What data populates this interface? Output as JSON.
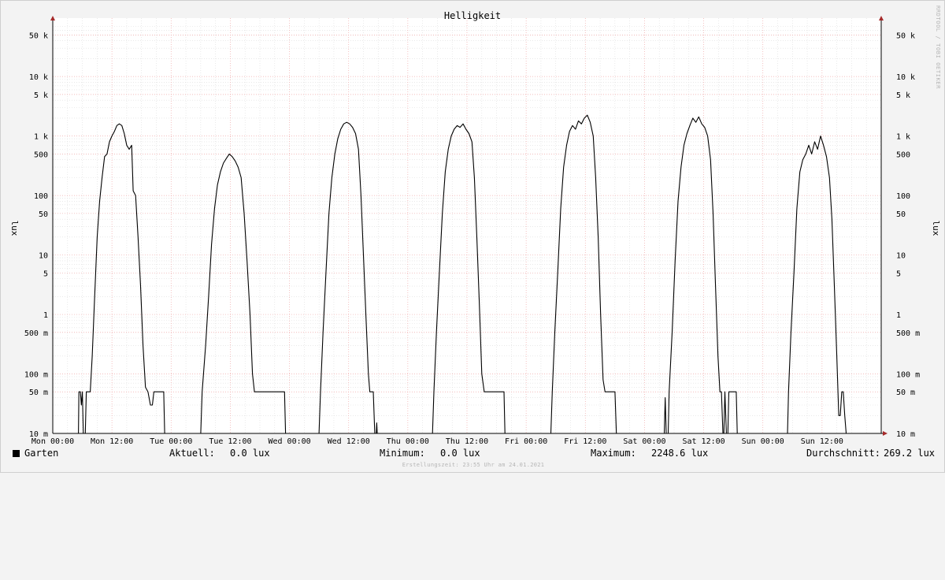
{
  "chart_data": {
    "type": "line",
    "title": "Helligkeit",
    "ylabel": "lux",
    "yscale": "log",
    "ylim": [
      0.01,
      80000
    ],
    "y_ticks": [
      {
        "v": 0.01,
        "label": "10 m"
      },
      {
        "v": 0.05,
        "label": "50 m"
      },
      {
        "v": 0.1,
        "label": "100 m"
      },
      {
        "v": 0.5,
        "label": "500 m"
      },
      {
        "v": 1,
        "label": "1"
      },
      {
        "v": 5,
        "label": "5"
      },
      {
        "v": 10,
        "label": "10"
      },
      {
        "v": 50,
        "label": "50"
      },
      {
        "v": 100,
        "label": "100"
      },
      {
        "v": 500,
        "label": "500"
      },
      {
        "v": 1000,
        "label": "1 k"
      },
      {
        "v": 5000,
        "label": "5 k"
      },
      {
        "v": 10000,
        "label": "10 k"
      },
      {
        "v": 50000,
        "label": "50 k"
      }
    ],
    "xlim": [
      "Mon 00:00",
      "Mon 00:00 (next week)"
    ],
    "x_tick_labels": [
      "Mon 00:00",
      "Mon 12:00",
      "Tue 00:00",
      "Tue 12:00",
      "Wed 00:00",
      "Wed 12:00",
      "Thu 00:00",
      "Thu 12:00",
      "Fri 00:00",
      "Fri 12:00",
      "Sat 00:00",
      "Sat 12:00",
      "Sun 00:00",
      "Sun 12:00"
    ],
    "x_hours_per_tick": 12,
    "grid": true,
    "series": [
      {
        "name": "Garten",
        "color": "#000000",
        "x_unit": "hours since Mon 00:00",
        "points": [
          [
            0,
            0.01
          ],
          [
            5.2,
            0.01
          ],
          [
            5.3,
            0.05
          ],
          [
            5.6,
            0.05
          ],
          [
            5.8,
            0.03
          ],
          [
            6.0,
            0.05
          ],
          [
            6.2,
            0.01
          ],
          [
            6.6,
            0.01
          ],
          [
            6.8,
            0.05
          ],
          [
            7.6,
            0.05
          ],
          [
            8.0,
            0.2
          ],
          [
            8.5,
            2
          ],
          [
            9.0,
            20
          ],
          [
            9.5,
            80
          ],
          [
            10.0,
            200
          ],
          [
            10.5,
            450
          ],
          [
            11.0,
            500
          ],
          [
            11.5,
            800
          ],
          [
            12.0,
            1000
          ],
          [
            12.5,
            1200
          ],
          [
            13.0,
            1500
          ],
          [
            13.5,
            1600
          ],
          [
            14.0,
            1500
          ],
          [
            14.5,
            1100
          ],
          [
            15.0,
            700
          ],
          [
            15.5,
            600
          ],
          [
            16.0,
            700
          ],
          [
            16.3,
            120
          ],
          [
            16.8,
            100
          ],
          [
            17.3,
            20
          ],
          [
            17.8,
            3
          ],
          [
            18.3,
            0.3
          ],
          [
            18.8,
            0.06
          ],
          [
            19.3,
            0.05
          ],
          [
            19.8,
            0.03
          ],
          [
            20.2,
            0.03
          ],
          [
            20.5,
            0.05
          ],
          [
            22.5,
            0.05
          ],
          [
            22.7,
            0.01
          ],
          [
            30.0,
            0.01
          ],
          [
            30.3,
            0.05
          ],
          [
            31.0,
            0.3
          ],
          [
            31.6,
            2
          ],
          [
            32.2,
            15
          ],
          [
            32.8,
            60
          ],
          [
            33.4,
            150
          ],
          [
            34.0,
            250
          ],
          [
            34.6,
            350
          ],
          [
            35.2,
            420
          ],
          [
            35.8,
            500
          ],
          [
            36.4,
            450
          ],
          [
            37.0,
            380
          ],
          [
            37.6,
            300
          ],
          [
            38.2,
            200
          ],
          [
            38.8,
            50
          ],
          [
            39.4,
            8
          ],
          [
            40.0,
            1
          ],
          [
            40.5,
            0.1
          ],
          [
            40.9,
            0.05
          ],
          [
            47.0,
            0.05
          ],
          [
            47.2,
            0.01
          ],
          [
            54.0,
            0.01
          ],
          [
            54.3,
            0.05
          ],
          [
            54.8,
            0.5
          ],
          [
            55.4,
            5
          ],
          [
            56.0,
            50
          ],
          [
            56.6,
            200
          ],
          [
            57.2,
            500
          ],
          [
            57.8,
            900
          ],
          [
            58.4,
            1300
          ],
          [
            59.0,
            1600
          ],
          [
            59.6,
            1700
          ],
          [
            60.2,
            1600
          ],
          [
            60.8,
            1400
          ],
          [
            61.4,
            1100
          ],
          [
            62.0,
            600
          ],
          [
            62.5,
            100
          ],
          [
            63.0,
            10
          ],
          [
            63.5,
            1
          ],
          [
            64.0,
            0.1
          ],
          [
            64.3,
            0.05
          ],
          [
            65.0,
            0.05
          ],
          [
            65.3,
            0.01
          ],
          [
            65.6,
            0.01
          ],
          [
            65.7,
            0.015
          ],
          [
            65.8,
            0.01
          ],
          [
            77.0,
            0.01
          ],
          [
            77.3,
            0.05
          ],
          [
            77.8,
            0.5
          ],
          [
            78.4,
            5
          ],
          [
            79.0,
            50
          ],
          [
            79.6,
            250
          ],
          [
            80.2,
            600
          ],
          [
            80.8,
            1000
          ],
          [
            81.4,
            1300
          ],
          [
            82.0,
            1500
          ],
          [
            82.6,
            1400
          ],
          [
            83.2,
            1600
          ],
          [
            83.8,
            1300
          ],
          [
            84.4,
            1100
          ],
          [
            85.0,
            800
          ],
          [
            85.5,
            200
          ],
          [
            86.0,
            20
          ],
          [
            86.5,
            1.5
          ],
          [
            87.0,
            0.1
          ],
          [
            87.5,
            0.05
          ],
          [
            91.5,
            0.05
          ],
          [
            91.7,
            0.01
          ],
          [
            101.0,
            0.01
          ],
          [
            101.3,
            0.05
          ],
          [
            101.8,
            0.5
          ],
          [
            102.4,
            5
          ],
          [
            103.0,
            60
          ],
          [
            103.6,
            300
          ],
          [
            104.2,
            700
          ],
          [
            104.8,
            1200
          ],
          [
            105.4,
            1500
          ],
          [
            106.0,
            1300
          ],
          [
            106.6,
            1800
          ],
          [
            107.2,
            1600
          ],
          [
            107.8,
            2000
          ],
          [
            108.4,
            2248.6
          ],
          [
            109.0,
            1700
          ],
          [
            109.6,
            1000
          ],
          [
            110.1,
            200
          ],
          [
            110.6,
            20
          ],
          [
            111.1,
            1
          ],
          [
            111.6,
            0.08
          ],
          [
            112.0,
            0.05
          ],
          [
            114.0,
            0.05
          ],
          [
            114.3,
            0.01
          ],
          [
            124.0,
            0.01
          ],
          [
            124.2,
            0.04
          ],
          [
            124.4,
            0.01
          ],
          [
            124.8,
            0.01
          ],
          [
            125.0,
            0.05
          ],
          [
            125.6,
            0.5
          ],
          [
            126.2,
            8
          ],
          [
            126.8,
            80
          ],
          [
            127.4,
            300
          ],
          [
            128.0,
            700
          ],
          [
            128.6,
            1100
          ],
          [
            129.2,
            1500
          ],
          [
            129.8,
            2000
          ],
          [
            130.4,
            1700
          ],
          [
            131.0,
            2100
          ],
          [
            131.6,
            1600
          ],
          [
            132.2,
            1400
          ],
          [
            132.8,
            1000
          ],
          [
            133.4,
            400
          ],
          [
            133.9,
            50
          ],
          [
            134.4,
            3
          ],
          [
            134.9,
            0.2
          ],
          [
            135.3,
            0.05
          ],
          [
            135.6,
            0.05
          ],
          [
            135.9,
            0.01
          ],
          [
            136.1,
            0.01
          ],
          [
            136.3,
            0.05
          ],
          [
            136.6,
            0.01
          ],
          [
            136.9,
            0.01
          ],
          [
            137.1,
            0.05
          ],
          [
            138.6,
            0.05
          ],
          [
            138.8,
            0.01
          ],
          [
            149.0,
            0.01
          ],
          [
            149.2,
            0.05
          ],
          [
            149.7,
            0.5
          ],
          [
            150.3,
            5
          ],
          [
            150.9,
            60
          ],
          [
            151.5,
            250
          ],
          [
            152.1,
            400
          ],
          [
            152.7,
            500
          ],
          [
            153.3,
            700
          ],
          [
            153.9,
            500
          ],
          [
            154.5,
            800
          ],
          [
            155.1,
            600
          ],
          [
            155.7,
            1000
          ],
          [
            156.3,
            700
          ],
          [
            156.9,
            450
          ],
          [
            157.5,
            200
          ],
          [
            158.0,
            40
          ],
          [
            158.5,
            3
          ],
          [
            159.0,
            0.2
          ],
          [
            159.4,
            0.02
          ],
          [
            159.7,
            0.02
          ],
          [
            160.0,
            0.05
          ],
          [
            160.3,
            0.05
          ],
          [
            160.6,
            0.02
          ],
          [
            160.9,
            0.01
          ],
          [
            168.0,
            0.01
          ]
        ]
      }
    ]
  },
  "legend": {
    "series_name": "Garten",
    "current_label": "Aktuell:",
    "current_value": "0.0 lux",
    "min_label": "Minimum:",
    "min_value": "0.0 lux",
    "max_label": "Maximum:",
    "max_value": "2248.6 lux",
    "avg_label": "Durchschnitt:",
    "avg_value": "269.2 lux"
  },
  "footer": "Erstellungszeit: 23:55 Uhr am 24.01.2021",
  "watermark": "RRDTOOL / TOBI OETIKER",
  "colors": {
    "background": "#f3f3f3",
    "plot": "#ffffff",
    "grid_major": "#f0a8a8",
    "grid_minor": "#dcdcdc",
    "axis_arrow": "#a52a2a",
    "line": "#000000"
  }
}
